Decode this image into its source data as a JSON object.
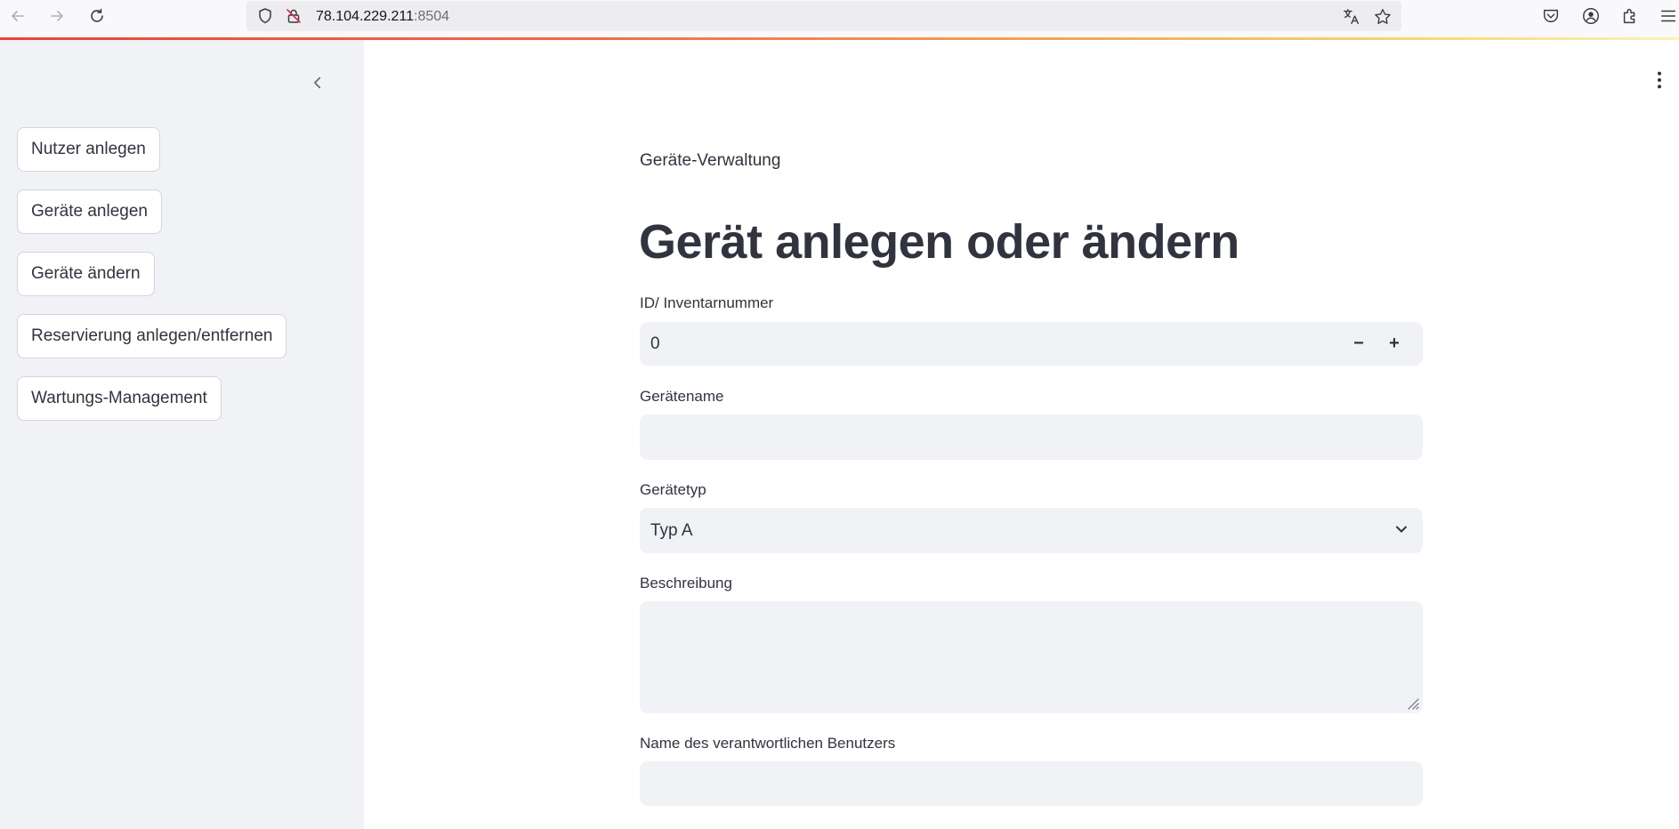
{
  "browser": {
    "url_host": "78.104.229.211",
    "url_port": ":8504"
  },
  "sidebar": {
    "buttons": [
      {
        "label": "Nutzer anlegen"
      },
      {
        "label": "Geräte anlegen"
      },
      {
        "label": "Geräte ändern"
      },
      {
        "label": "Reservierung anlegen/entfernen"
      },
      {
        "label": "Wartungs-Management"
      }
    ]
  },
  "main": {
    "caption": "Geräte-Verwaltung",
    "title": "Gerät anlegen oder ändern",
    "fields": {
      "id": {
        "label": "ID/ Inventarnummer",
        "value": "0",
        "minus": "−",
        "plus": "+"
      },
      "name": {
        "label": "Gerätename",
        "value": ""
      },
      "type": {
        "label": "Gerätetyp",
        "value": "Typ A"
      },
      "description": {
        "label": "Beschreibung",
        "value": ""
      },
      "responsible": {
        "label": "Name des verantwortlichen Benutzers",
        "value": ""
      }
    }
  },
  "colors": {
    "sidebar_bg": "#f0f2f6",
    "field_bg": "#f0f2f6",
    "text": "#31333f",
    "accent_line": "#e8453c"
  }
}
